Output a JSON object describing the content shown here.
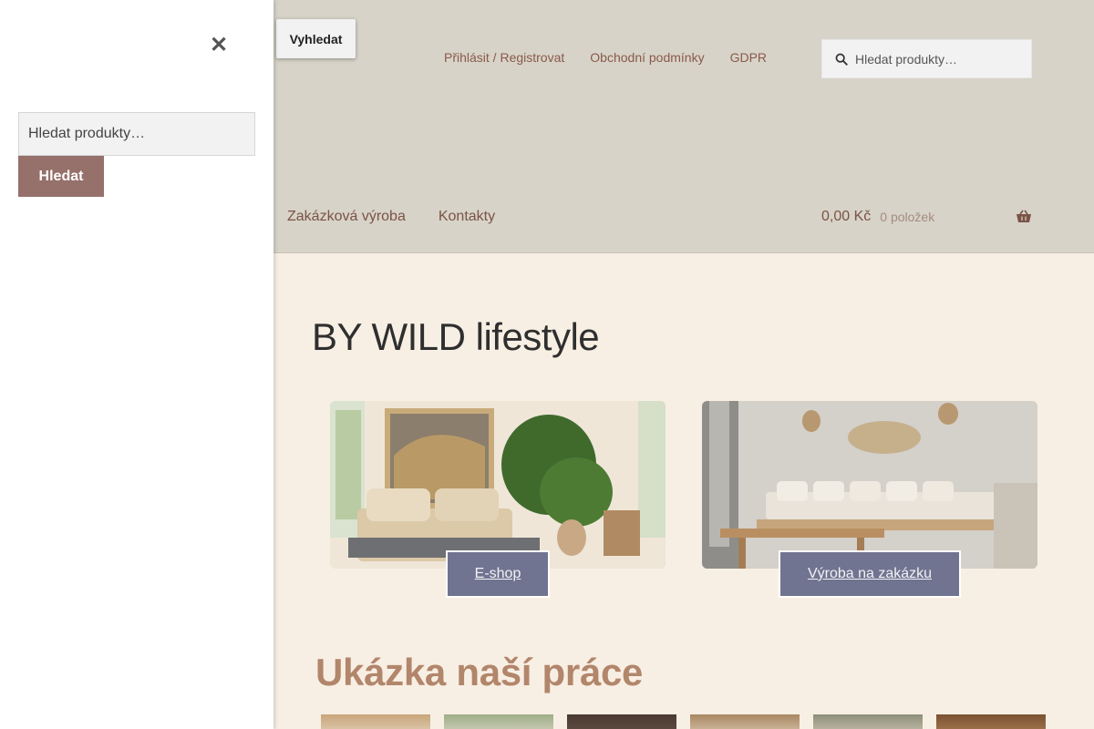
{
  "header": {
    "skip_link": "Vyhledat",
    "top_links": [
      "Přihlásit / Registrovat",
      "Obchodní podmínky",
      "GDPR"
    ],
    "search_placeholder": "Hledat produkty…",
    "nav": [
      "Zakázková výroba",
      "Kontakty"
    ],
    "cart": {
      "amount": "0,00 Kč",
      "count": "0 položek",
      "icon": "basket-icon"
    }
  },
  "main": {
    "site_title": "BY WILD lifestyle",
    "cards": [
      {
        "button": "E-shop",
        "image": "living-room-photo"
      },
      {
        "button": "Výroba na zakázku",
        "image": "cafe-interior-photo"
      }
    ],
    "section_heading": "Ukázka naší práce"
  },
  "drawer": {
    "close_icon": "close-icon",
    "search_placeholder": "Hledat produkty…",
    "submit_label": "Hledat"
  },
  "colors": {
    "header_bg": "#d7d3c8",
    "page_bg": "#f8efe4",
    "nav_text": "#7b5346",
    "button_bg": "#717490",
    "drawer_button_bg": "#96706a",
    "heading_accent": "#b2866b"
  }
}
